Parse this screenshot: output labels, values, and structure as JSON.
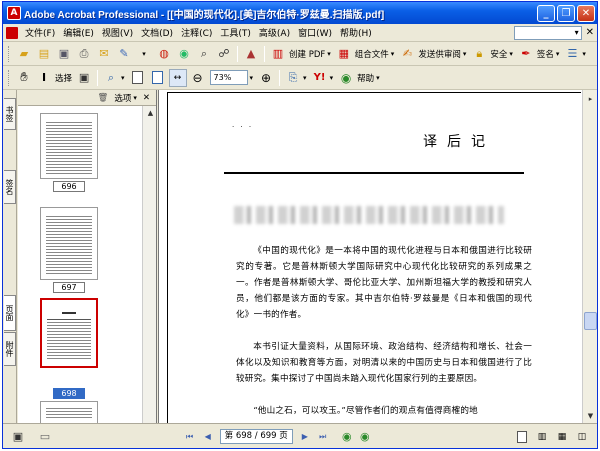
{
  "window": {
    "title": "Adobe Acrobat Professional - [[中国的现代化].[美]吉尔伯特·罗兹曼.扫描版.pdf]"
  },
  "menubar": {
    "items": [
      "文件(F)",
      "编辑(E)",
      "视图(V)",
      "文档(D)",
      "注释(C)",
      "工具(T)",
      "高级(A)",
      "窗口(W)",
      "帮助(H)"
    ]
  },
  "toolbar1": {
    "create_pdf": "创建 PDF",
    "combine": "组合文件",
    "send_review": "发送供审阅",
    "secure": "安全",
    "sign": "签名"
  },
  "toolbar2": {
    "select_label": "选择",
    "zoom_value": "73%",
    "help_label": "帮助"
  },
  "panel": {
    "options_label": "选项",
    "tabs": [
      "书签",
      "签名",
      "页面",
      "附件"
    ],
    "thumbnails": [
      {
        "label": "696",
        "selected": false
      },
      {
        "label": "697",
        "selected": false
      },
      {
        "label": "698",
        "selected": true
      }
    ]
  },
  "document": {
    "heading": "译后记",
    "mark": "· · ·",
    "paragraphs": [
      "《中国的现代化》是一本将中国的现代化进程与日本和俄国进行比较研究的专著。它是普林斯顿大学国际研究中心现代化比较研究的系列成果之一。作者是普林斯顿大学、哥伦比亚大学、加州斯坦福大学的教授和研究人员，他们都是该方面的专家。其中吉尔伯特·罗兹曼是《日本和俄国的现代化》一书的作者。",
      "本书引证大量资料，从国际环境、政治结构、经济结构和增长、社会一体化以及知识和教育等方面，对明清以来的中国历史与日本和俄国进行了比较研究。集中探讨了中国尚未踏入现代化国家行列的主要原因。",
      "“他山之石，可以攻玉。”尽管作者们的观点有值得商榷的地"
    ]
  },
  "statusbar": {
    "page_display": "第 698 / 699 页"
  },
  "colors": {
    "title_bar": "#0a5fe6",
    "selection": "#316ac5",
    "page_marker": "#cc0000"
  }
}
